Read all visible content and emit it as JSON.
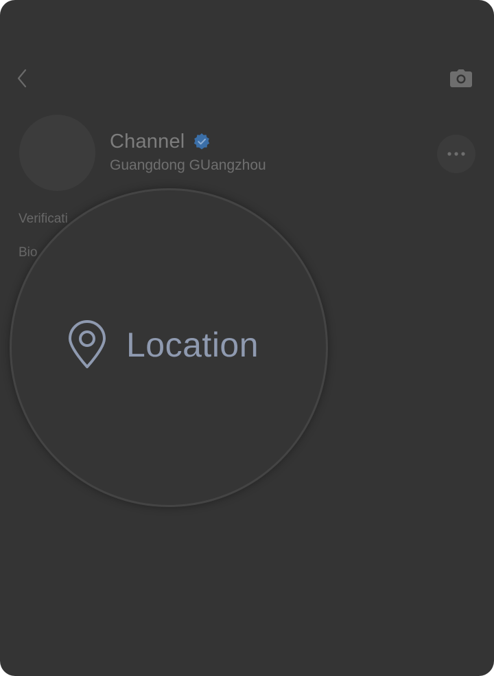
{
  "header": {
    "back_icon": "chevron-left-icon",
    "camera_icon": "camera-icon"
  },
  "profile": {
    "name": "Channel",
    "verified_icon": "verified-badge-icon",
    "location": "Guangdong GUangzhou",
    "more_icon": "more-horizontal-icon"
  },
  "fields": {
    "verification_label": "Verificati",
    "bio_label": "Bio"
  },
  "magnifier": {
    "location_icon": "map-pin-icon",
    "location_label": "Location"
  },
  "colors": {
    "background": "#343434",
    "accent_blue": "#3b6fa8",
    "magnified_text": "#8f9ab0"
  }
}
